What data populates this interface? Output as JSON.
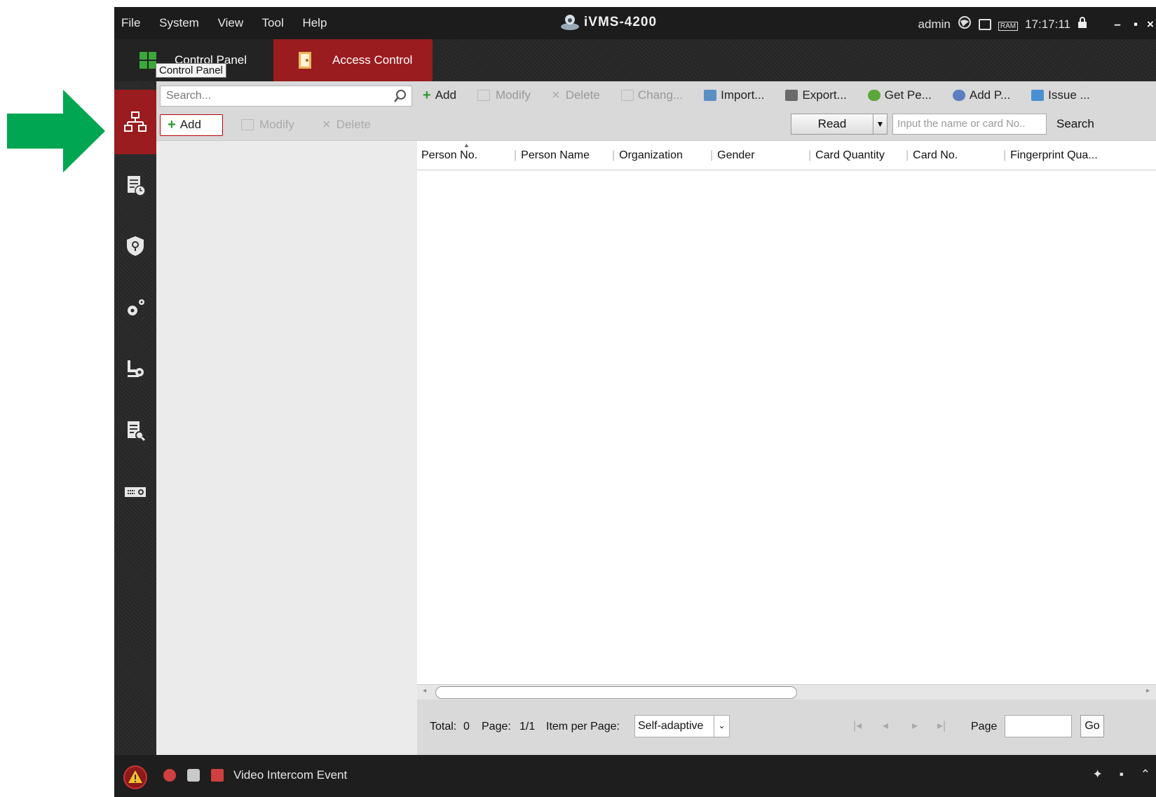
{
  "window": {
    "menu": [
      "File",
      "System",
      "View",
      "Tool",
      "Help"
    ],
    "title": "iVMS-4200",
    "user": "admin",
    "time": "17:17:11",
    "tray_icons": [
      "globe-icon",
      "cpu-icon",
      "ram-icon",
      "lock-icon"
    ],
    "ram_label": "RAM"
  },
  "tabs": [
    {
      "label": "Control Panel"
    },
    {
      "label": "Access Control",
      "active": true
    }
  ],
  "tooltip": "Control Panel",
  "nav": [
    {
      "name": "person-management-icon",
      "active": true
    },
    {
      "name": "schedule-icon"
    },
    {
      "name": "shield-icon"
    },
    {
      "name": "settings-icon"
    },
    {
      "name": "intercom-icon"
    },
    {
      "name": "search-records-icon"
    },
    {
      "name": "device-icon"
    }
  ],
  "tree": {
    "search_placeholder": "Search...",
    "add_label": "Add",
    "modify_label": "Modify",
    "delete_label": "Delete"
  },
  "toolbar": {
    "add": "Add",
    "modify": "Modify",
    "delete": "Delete",
    "change": "Chang...",
    "import": "Import...",
    "export": "Export...",
    "get_person": "Get Pe...",
    "add_person": "Add P...",
    "issue": "Issue ..."
  },
  "filter": {
    "read_label": "Read",
    "input_placeholder": "Input the name or card No..",
    "search_label": "Search"
  },
  "grid": {
    "columns": [
      "Person No.",
      "Person Name",
      "Organization",
      "Gender",
      "Card Quantity",
      "Card No.",
      "Fingerprint Qua..."
    ],
    "rows": []
  },
  "pager": {
    "total_label": "Total:",
    "total": "0",
    "page_label": "Page:",
    "page": "1/1",
    "ipp_label": "Item per Page:",
    "ipp_value": "Self-adaptive",
    "goto_label": "Page",
    "go_label": "Go"
  },
  "status": {
    "event_text": "Video Intercom Event"
  },
  "colors": {
    "accent": "#9b1c1f",
    "arrow": "#00a651"
  }
}
